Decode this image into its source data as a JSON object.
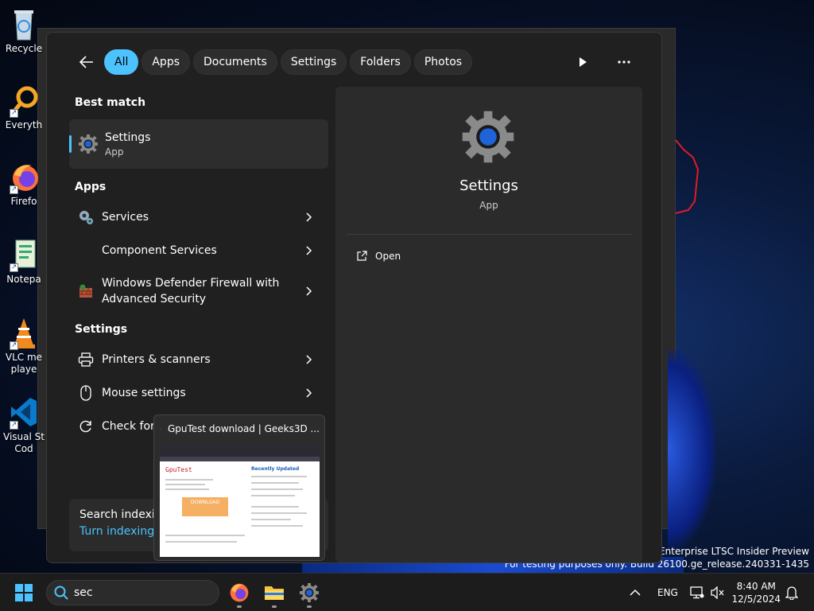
{
  "desktop": {
    "icons": [
      {
        "label": "Recycle",
        "icon": "recycle-bin-icon"
      },
      {
        "label": "Everyth",
        "icon": "everything-search-icon"
      },
      {
        "label": "Firefo",
        "icon": "firefox-icon"
      },
      {
        "label": "Notepa",
        "icon": "notepad-icon"
      },
      {
        "label": "VLC me",
        "label2": "playe",
        "icon": "vlc-icon"
      },
      {
        "label": "Visual St",
        "label2": "Cod",
        "icon": "vscode-icon"
      }
    ],
    "watermark_line1": "IoT Enterprise LTSC Insider Preview",
    "watermark_line2": "For testing purposes only. Build 26100.ge_release.240331-1435"
  },
  "search_panel": {
    "filters": [
      "All",
      "Apps",
      "Documents",
      "Settings",
      "Folders",
      "Photos"
    ],
    "active_filter": "All",
    "best_match_title": "Best match",
    "best_match": {
      "name": "Settings",
      "type": "App"
    },
    "apps_title": "Apps",
    "apps": [
      {
        "name": "Services"
      },
      {
        "name": "Component Services"
      },
      {
        "name": "Windows Defender Firewall with",
        "name2": "Advanced Security"
      }
    ],
    "settings_title": "Settings",
    "settings": [
      {
        "name": "Printers & scanners"
      },
      {
        "name": "Mouse settings"
      },
      {
        "name": "Check for u"
      }
    ],
    "indexing": {
      "line1": "Search indexing",
      "line2": "Turn indexing b"
    },
    "detail": {
      "name": "Settings",
      "type": "App",
      "action": "Open"
    }
  },
  "preview": {
    "title": "GpuTest download | Geeks3D ...",
    "page_heading": "GpuTest",
    "side_heading": "Recently Updated",
    "button": "DOWNLOAD"
  },
  "taskbar": {
    "search_value": "sec",
    "language": "ENG",
    "time": "8:40 AM",
    "date": "12/5/2024"
  },
  "colors": {
    "accent": "#4cc2ff",
    "panel": "#202020",
    "card": "#2b2b2b"
  }
}
